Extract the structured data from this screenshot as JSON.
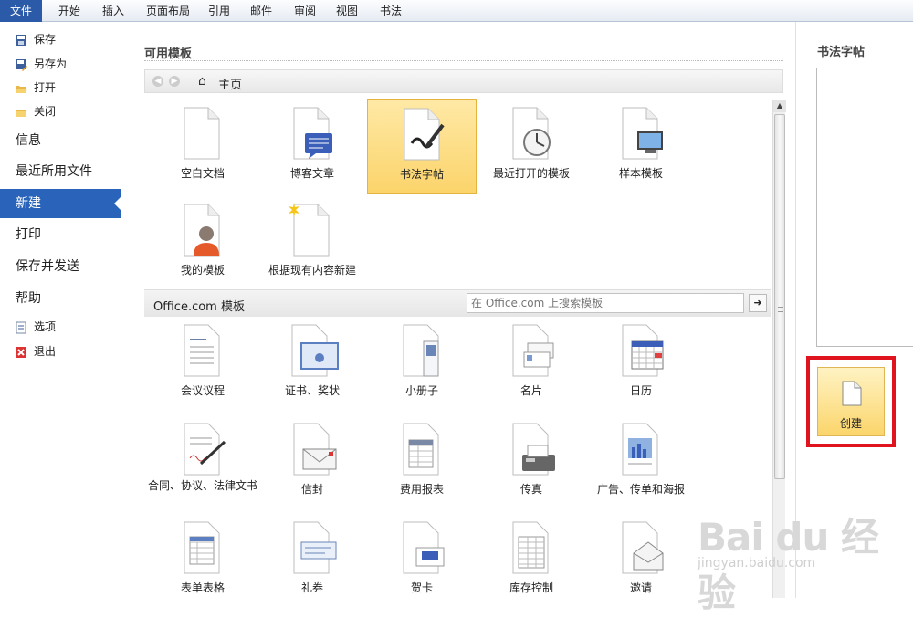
{
  "ribbon": {
    "tabs": [
      "文件",
      "开始",
      "插入",
      "页面布局",
      "引用",
      "邮件",
      "审阅",
      "视图",
      "书法"
    ]
  },
  "nav": {
    "small_top": [
      {
        "label": "保存",
        "icon": "save-icon"
      },
      {
        "label": "另存为",
        "icon": "save-as-icon"
      },
      {
        "label": "打开",
        "icon": "open-folder-icon"
      },
      {
        "label": "关闭",
        "icon": "close-folder-icon"
      }
    ],
    "big": [
      {
        "label": "信息"
      },
      {
        "label": "最近所用文件"
      },
      {
        "label": "新建"
      },
      {
        "label": "打印"
      },
      {
        "label": "保存并发送"
      },
      {
        "label": "帮助"
      }
    ],
    "small_bottom": [
      {
        "label": "选项",
        "icon": "options-icon"
      },
      {
        "label": "退出",
        "icon": "exit-icon"
      }
    ],
    "active": "新建"
  },
  "available": {
    "title": "可用模板",
    "breadcrumb": "主页",
    "tiles": [
      {
        "label": "空白文档",
        "icon": "blank-document-icon"
      },
      {
        "label": "博客文章",
        "icon": "blog-post-icon"
      },
      {
        "label": "书法字帖",
        "icon": "calligraphy-icon"
      },
      {
        "label": "最近打开的模板",
        "icon": "recent-templates-icon"
      },
      {
        "label": "样本模板",
        "icon": "sample-templates-icon"
      },
      {
        "label": "我的模板",
        "icon": "my-templates-icon"
      },
      {
        "label": "根据现有内容新建",
        "icon": "new-from-existing-icon"
      }
    ],
    "selected": "书法字帖"
  },
  "office": {
    "title": "Office.com 模板",
    "search_placeholder": "在 Office.com 上搜索模板",
    "tiles": [
      {
        "label": "会议议程",
        "icon": "agenda-icon"
      },
      {
        "label": "证书、奖状",
        "icon": "certificate-icon"
      },
      {
        "label": "小册子",
        "icon": "brochure-icon"
      },
      {
        "label": "名片",
        "icon": "business-card-icon"
      },
      {
        "label": "日历",
        "icon": "calendar-icon"
      },
      {
        "label": "合同、协议、法律文书",
        "icon": "contract-icon"
      },
      {
        "label": "信封",
        "icon": "envelope-icon"
      },
      {
        "label": "费用报表",
        "icon": "expense-report-icon"
      },
      {
        "label": "传真",
        "icon": "fax-icon"
      },
      {
        "label": "广告、传单和海报",
        "icon": "flyer-icon"
      },
      {
        "label": "表单表格",
        "icon": "form-icon"
      },
      {
        "label": "礼券",
        "icon": "gift-certificate-icon"
      },
      {
        "label": "贺卡",
        "icon": "greeting-card-icon"
      },
      {
        "label": "库存控制",
        "icon": "inventory-icon"
      },
      {
        "label": "邀请",
        "icon": "invitation-icon"
      }
    ]
  },
  "preview": {
    "title": "书法字帖",
    "create_label": "创建"
  },
  "watermark": {
    "main": "Bai du 经验",
    "sub": "jingyan.baidu.com"
  },
  "colors": {
    "file_tab": "#2a5aa8",
    "nav_active": "#2a64ba",
    "selected_tile": "#fbd46b",
    "highlight_box": "#e0141e"
  }
}
